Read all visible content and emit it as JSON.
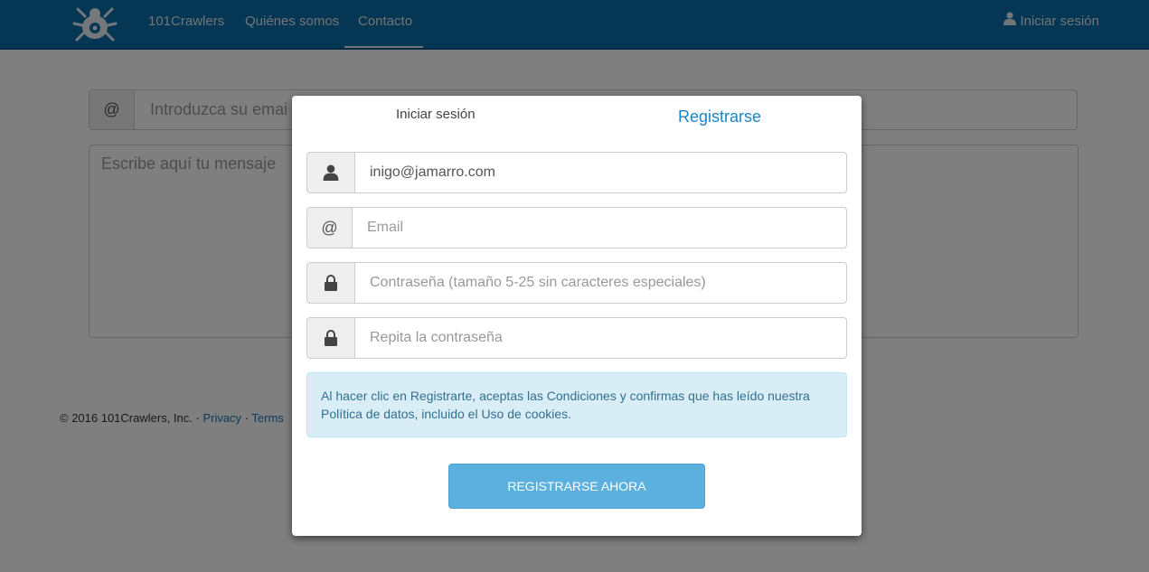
{
  "navbar": {
    "brand_icon": "spider-logo-icon",
    "links": [
      "101Crawlers",
      "Quiénes somos",
      "Contacto"
    ],
    "active_link": "Contacto",
    "login_label": "Iniciar sesión",
    "color": "#0a6fa8"
  },
  "background": {
    "email_addon": "@",
    "email_placeholder": "Introduzca su emai",
    "message_placeholder": "Escribe aquí tu mensaje",
    "footer_text": "© 2016 101Crawlers, Inc. · ",
    "footer_privacy": "Privacy",
    "footer_sep": " · ",
    "footer_terms": "Terms"
  },
  "modal": {
    "tab_login": "Iniciar sesión",
    "tab_register": "Registrarse",
    "username_value": "inigo@jamarro.com",
    "email_addon": "@",
    "email_placeholder": "Email",
    "password_placeholder": "Contraseña (tamaño 5-25 sin caracteres especiales)",
    "repeat_placeholder": "Repita la contraseña",
    "info_text": "Al hacer clic en Registrarte, aceptas las Condiciones y confirmas que has leído nuestra Política de datos, incluido el Uso de cookies.",
    "submit_label": "REGISTRARSE AHORA",
    "accent_color": "#1a85c6",
    "button_color": "#5bb0de"
  }
}
